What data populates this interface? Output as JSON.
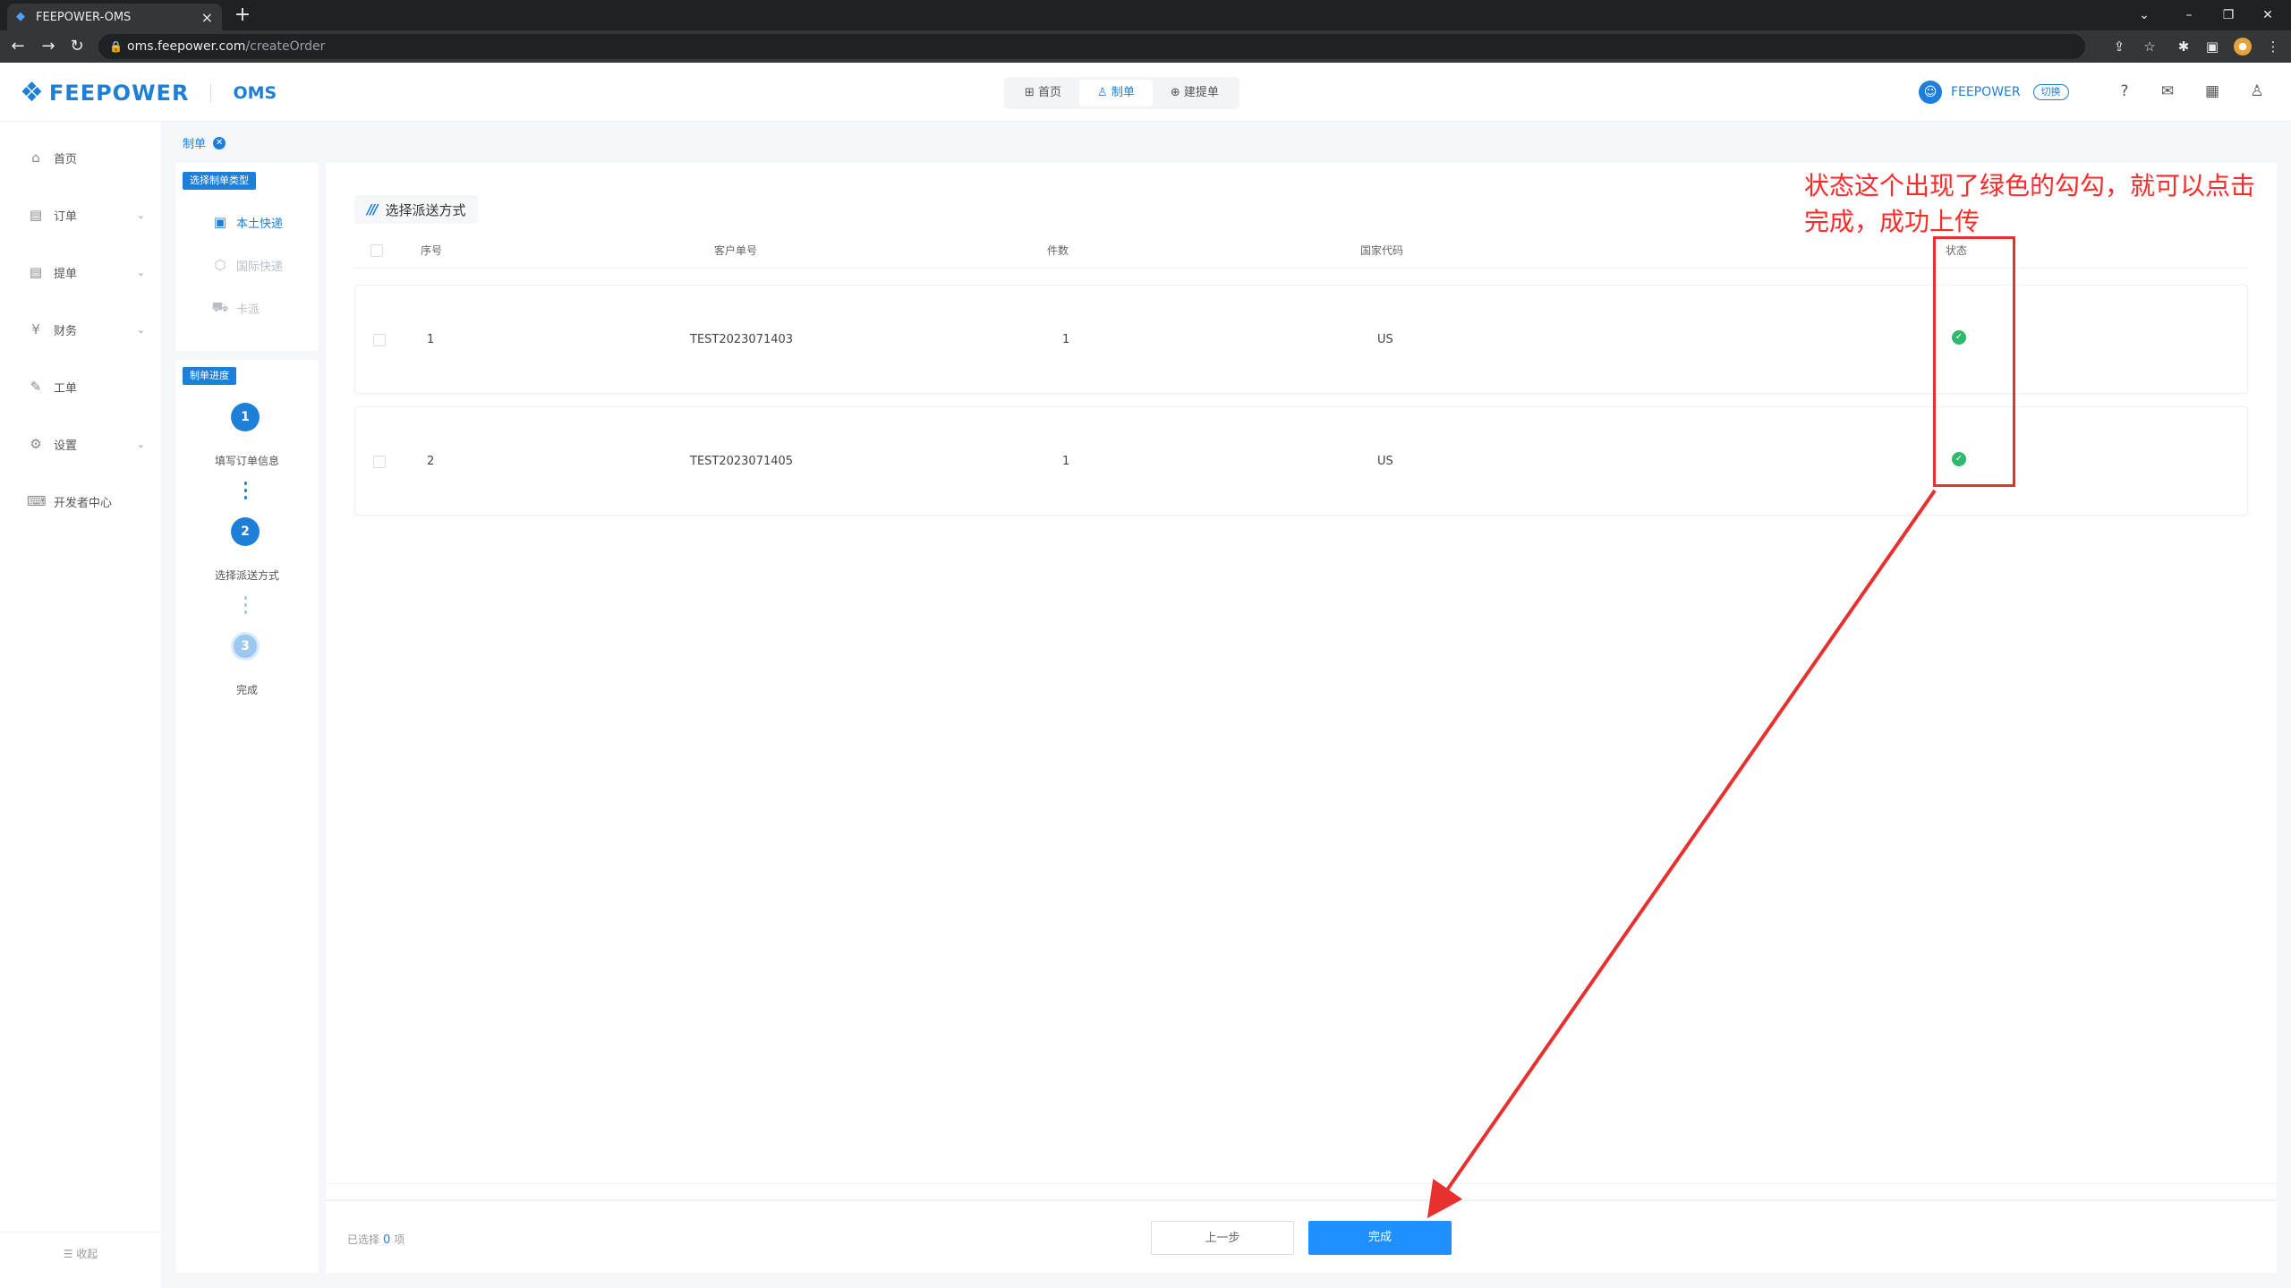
{
  "browser": {
    "tab_title": "FEEPOWER-OMS",
    "url_host": "oms.feepower.com",
    "url_path": "/createOrder"
  },
  "header": {
    "brand": "FEEPOWER",
    "product": "OMS",
    "nav": [
      {
        "label": "首页",
        "icon": "grid-icon"
      },
      {
        "label": "制单",
        "icon": "user-edit-icon",
        "active": true
      },
      {
        "label": "建提单",
        "icon": "doc-add-icon"
      }
    ],
    "user_name": "FEEPOWER",
    "switch_label": "切换"
  },
  "sidebar": {
    "items": [
      {
        "label": "首页",
        "icon": "home-icon"
      },
      {
        "label": "订单",
        "icon": "order-icon",
        "expandable": true
      },
      {
        "label": "提单",
        "icon": "bill-icon",
        "expandable": true
      },
      {
        "label": "财务",
        "icon": "finance-icon",
        "expandable": true
      },
      {
        "label": "工单",
        "icon": "ticket-icon"
      },
      {
        "label": "设置",
        "icon": "settings-icon",
        "expandable": true
      },
      {
        "label": "开发者中心",
        "icon": "developer-icon"
      }
    ],
    "collapse_label": "收起"
  },
  "breadcrumb": {
    "label": "制单"
  },
  "order_type": {
    "tag": "选择制单类型",
    "modes": [
      {
        "label": "本土快递",
        "state": "active"
      },
      {
        "label": "国际快递",
        "state": "disabled"
      },
      {
        "label": "卡派",
        "state": "disabled"
      }
    ]
  },
  "progress": {
    "tag": "制单进度",
    "steps": [
      {
        "num": "1",
        "label": "填写订单信息",
        "state": "done"
      },
      {
        "num": "2",
        "label": "选择派送方式",
        "state": "done"
      },
      {
        "num": "3",
        "label": "完成",
        "state": "todo"
      }
    ]
  },
  "main": {
    "section_title": "选择派送方式",
    "columns": {
      "seq": "序号",
      "customer_no": "客户单号",
      "pieces": "件数",
      "country": "国家代码",
      "status": "状态"
    },
    "rows": [
      {
        "seq": "1",
        "customer_no": "TEST2023071403",
        "pieces": "1",
        "country": "US",
        "status": "success"
      },
      {
        "seq": "2",
        "customer_no": "TEST2023071405",
        "pieces": "1",
        "country": "US",
        "status": "success"
      }
    ]
  },
  "footer": {
    "selected_prefix": "已选择",
    "selected_count": "0",
    "selected_suffix": "项",
    "prev_label": "上一步",
    "done_label": "完成"
  },
  "annotation": {
    "text": "状态这个出现了绿色的勾勾，就可以点击完成，成功上传",
    "color": "#ff2a2a"
  },
  "colors": {
    "accent": "#1e7fd8",
    "success": "#2dba6c",
    "primary_button": "#1e90ff"
  }
}
